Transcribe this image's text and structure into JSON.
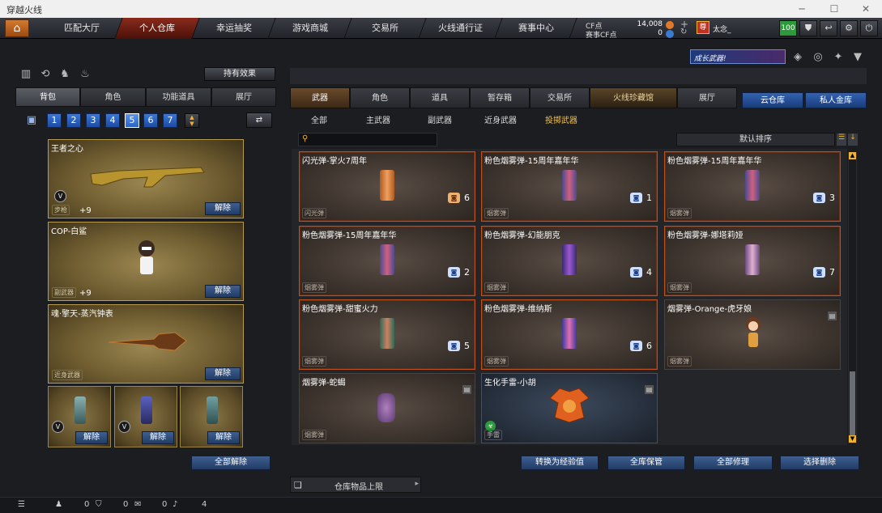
{
  "window": {
    "title": "穿越火线",
    "minimize": "─",
    "maximize": "☐",
    "close": "✕"
  },
  "nav": {
    "home_icon": "home-icon",
    "tabs": [
      "匹配大厅",
      "个人仓库",
      "幸运抽奖",
      "游戏商城",
      "交易所",
      "火线通行证",
      "赛事中心"
    ],
    "active_tab": "个人仓库"
  },
  "currency": {
    "cf_label": "CF点",
    "cf_value": "14,008",
    "match_cf_label": "赛事CF点",
    "match_cf_value": "0"
  },
  "user": {
    "rank_char": "尊",
    "name": "太念_",
    "level_badge": "100"
  },
  "banner": {
    "text": "成长武器!"
  },
  "left": {
    "effect_button": "持有效果",
    "tabs": [
      "背包",
      "角色",
      "功能道具",
      "展厅"
    ],
    "active_tab": "背包",
    "pages": [
      "1",
      "2",
      "3",
      "4",
      "5",
      "6",
      "7"
    ],
    "active_page": "5",
    "slots": [
      {
        "name": "王者之心",
        "type": "步枪",
        "level": "+9",
        "action": "解除"
      },
      {
        "name": "COP-白鲨",
        "type": "副武器",
        "level": "+9",
        "action": "解除"
      },
      {
        "name": "魂·擎天-蒸汽钟表",
        "type": "近身武器",
        "level": "",
        "action": "解除"
      }
    ],
    "grenade_slots": [
      {
        "action": "解除"
      },
      {
        "action": "解除"
      },
      {
        "action": "解除"
      }
    ],
    "unequip_all": "全部解除"
  },
  "right": {
    "tabs": [
      "武器",
      "角色",
      "道具",
      "暂存箱",
      "交易所",
      "火线珍藏馆",
      "展厅"
    ],
    "active_tab": "武器",
    "cloud_tabs": [
      "云仓库",
      "私人金库"
    ],
    "filters": [
      "全部",
      "主武器",
      "副武器",
      "近身武器",
      "投掷武器"
    ],
    "active_filter": "投掷武器",
    "search_placeholder": "",
    "sort_label": "默认排序",
    "items": [
      {
        "name": "闪光弹-掌火7周年",
        "type": "闪光弹",
        "count": "6",
        "trash": false,
        "style": "locked"
      },
      {
        "name": "粉色烟雾弹-15周年嘉年华",
        "type": "烟雾弹",
        "count": "1",
        "trash": false,
        "style": "locked"
      },
      {
        "name": "粉色烟雾弹-15周年嘉年华",
        "type": "烟雾弹",
        "count": "3",
        "trash": false,
        "style": "locked"
      },
      {
        "name": "粉色烟雾弹-15周年嘉年华",
        "type": "烟雾弹",
        "count": "2",
        "trash": false,
        "style": "locked"
      },
      {
        "name": "粉色烟雾弹-幻能朋克",
        "type": "烟雾弹",
        "count": "4",
        "trash": false,
        "style": "locked"
      },
      {
        "name": "粉色烟雾弹-娜塔莉娅",
        "type": "烟雾弹",
        "count": "7",
        "trash": false,
        "style": "locked"
      },
      {
        "name": "粉色烟雾弹-甜蜜火力",
        "type": "烟雾弹",
        "count": "5",
        "trash": false,
        "style": "locked"
      },
      {
        "name": "粉色烟雾弹-维纳斯",
        "type": "烟雾弹",
        "count": "6",
        "trash": false,
        "style": "locked"
      },
      {
        "name": "烟雾弹-Orange-虎牙娘",
        "type": "烟雾弹",
        "count": "",
        "trash": true,
        "style": "plain"
      },
      {
        "name": "烟雾弹-蛇蝎",
        "type": "烟雾弹",
        "count": "",
        "trash": true,
        "style": "plain"
      },
      {
        "name": "生化手雷-小胡",
        "type": "手雷",
        "count": "",
        "trash": true,
        "style": "bio"
      }
    ],
    "bottom_buttons": [
      "转换为经验值",
      "全库保管",
      "全部修理",
      "选择删除"
    ],
    "warehouse_limit": "仓库物品上限"
  },
  "status": {
    "friends": "0",
    "clan": "0",
    "chat": "0",
    "volume": "4"
  }
}
